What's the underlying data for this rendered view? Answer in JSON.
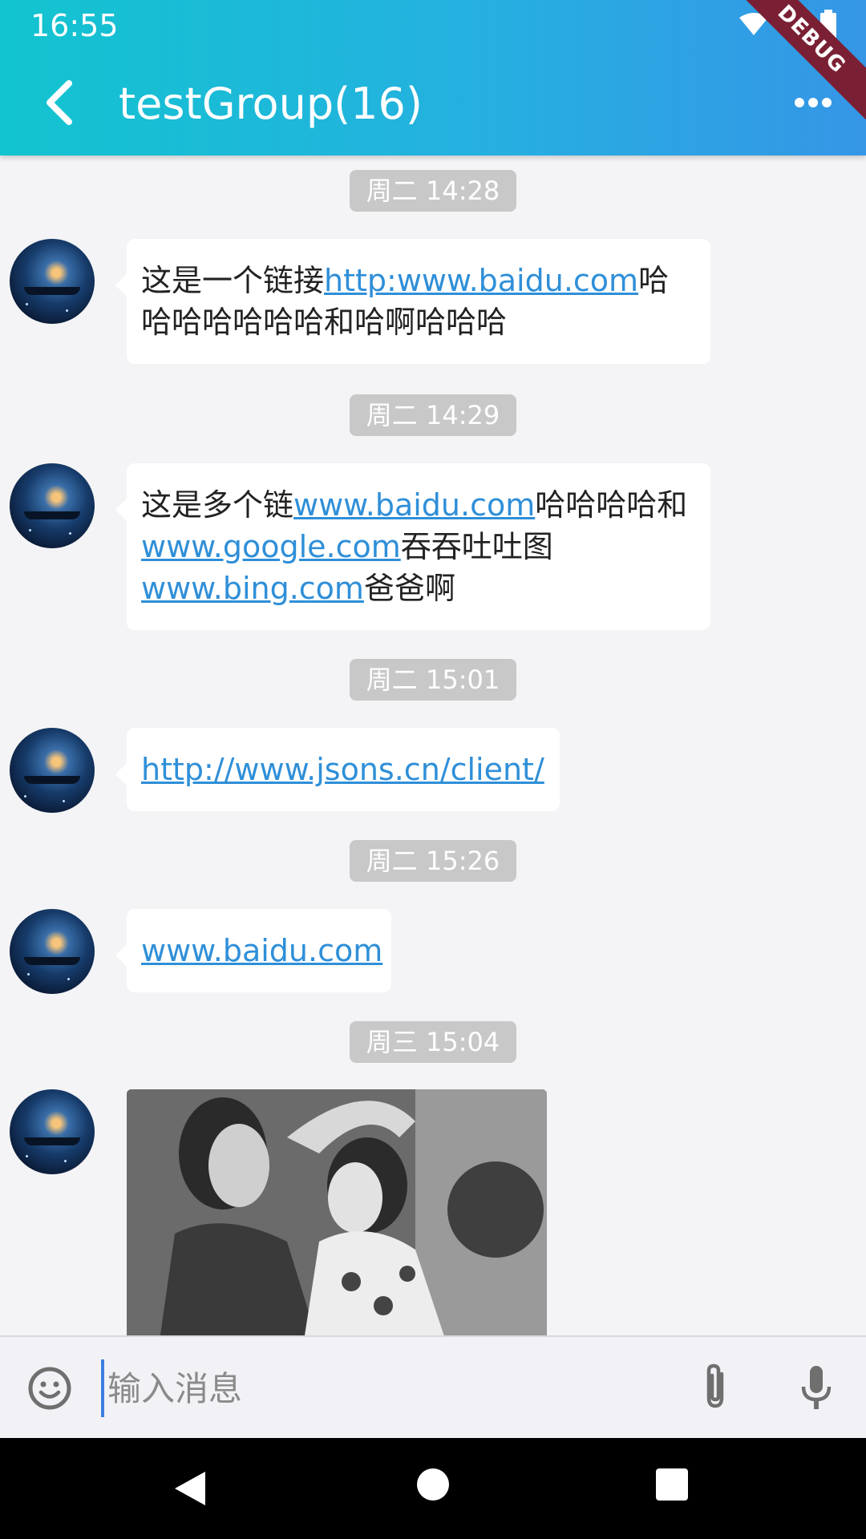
{
  "status_bar": {
    "time": "16:55",
    "debug_label": "DEBUG"
  },
  "header": {
    "title": "testGroup(16)"
  },
  "messages": [
    {
      "time": "周二 14:28",
      "parts": [
        {
          "text": "这是一个链接"
        },
        {
          "text": "http:www.baidu.com",
          "link": true
        },
        {
          "text": "哈哈哈哈哈哈哈和哈啊哈哈哈"
        }
      ]
    },
    {
      "time": "周二 14:29",
      "parts": [
        {
          "text": "这是多个链"
        },
        {
          "text": "www.baidu.com",
          "link": true
        },
        {
          "text": "哈哈哈哈和"
        },
        {
          "text": "www.google.com",
          "link": true
        },
        {
          "text": "吞吞吐吐图"
        },
        {
          "text": "www.bing.com",
          "link": true
        },
        {
          "text": "爸爸啊"
        }
      ]
    },
    {
      "time": "周二 15:01",
      "parts": [
        {
          "text": "http://www.jsons.cn/client/",
          "link": true
        }
      ]
    },
    {
      "time": "周二 15:26",
      "parts": [
        {
          "text": "www.baidu.com",
          "link": true
        }
      ]
    },
    {
      "time": "周三 15:04",
      "image": true
    }
  ],
  "input": {
    "placeholder": "输入消息",
    "value": ""
  },
  "colors": {
    "link": "#2f8fd8",
    "header_start": "#12c4cf",
    "header_end": "#3596e6",
    "cursor": "#3d7ee0"
  },
  "icons": [
    "back-arrow-icon",
    "more-dots-icon",
    "emoji-icon",
    "attachment-icon",
    "microphone-icon",
    "wifi-icon",
    "signal-icon",
    "battery-icon"
  ]
}
